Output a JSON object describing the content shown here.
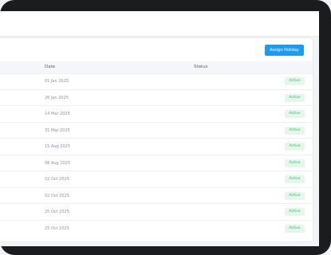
{
  "toolbar": {
    "assign_label": "Assign Holiday"
  },
  "table": {
    "columns": [
      "Date",
      "Status"
    ],
    "rows": [
      {
        "date": "01 Jan 2025",
        "status": "Active"
      },
      {
        "date": "26 Jan 2025",
        "status": "Active"
      },
      {
        "date": "14 Mar 2025",
        "status": "Active"
      },
      {
        "date": "31 Mar 2025",
        "status": "Active"
      },
      {
        "date": "15 Aug 2025",
        "status": "Active"
      },
      {
        "date": "08 Aug 2025",
        "status": "Active"
      },
      {
        "date": "02 Oct 2025",
        "status": "Active"
      },
      {
        "date": "02 Oct 2025",
        "status": "Active"
      },
      {
        "date": "25 Oct 2025",
        "status": "Active"
      },
      {
        "date": "25 Oct 2025",
        "status": "Active"
      }
    ]
  },
  "colors": {
    "accent": "#1e9be9",
    "status_active_bg": "#e4f7ea",
    "status_active_text": "#39b866"
  }
}
